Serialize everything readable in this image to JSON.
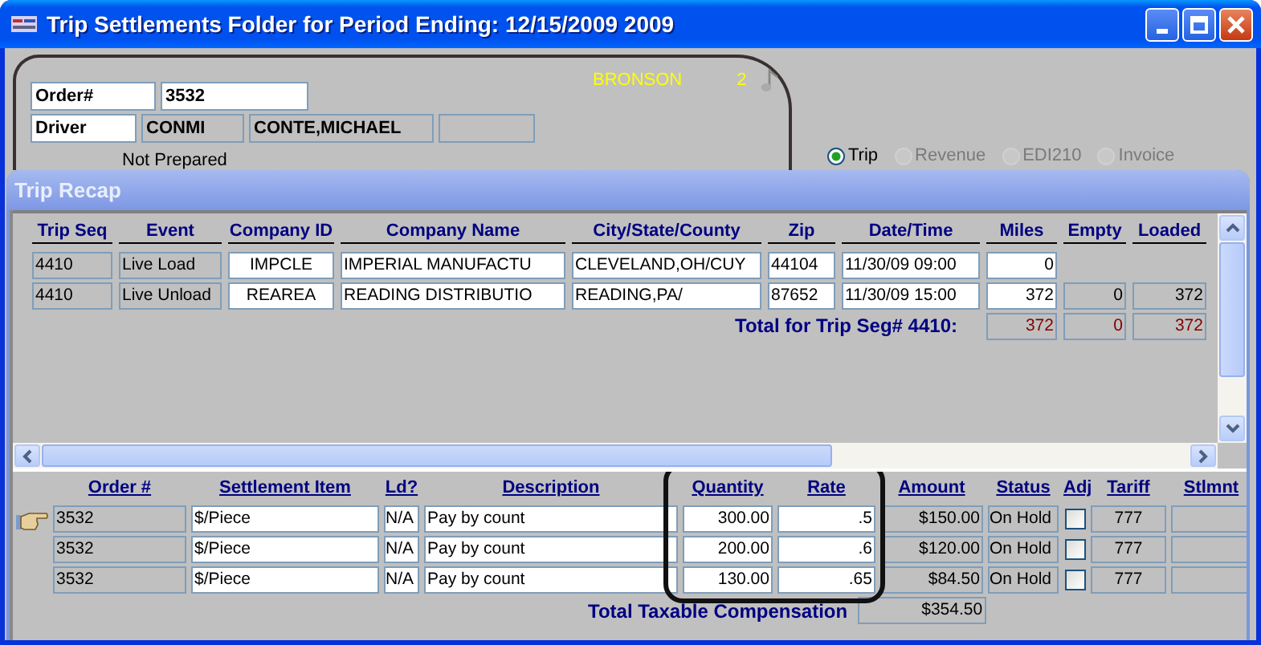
{
  "window": {
    "title": "Trip Settlements Folder for Period Ending: 12/15/2009 2009"
  },
  "header": {
    "order_label": "Order#",
    "order_value": "3532",
    "driver_label": "Driver",
    "driver_id": "CONMI",
    "driver_name": "CONTE,MICHAEL",
    "status": "Not Prepared",
    "terminal": "BRONSON",
    "count": "2"
  },
  "view_options": [
    {
      "label": "Trip",
      "selected": true,
      "disabled": false
    },
    {
      "label": "Revenue",
      "selected": false,
      "disabled": true
    },
    {
      "label": "EDI210",
      "selected": false,
      "disabled": true
    },
    {
      "label": "Invoice",
      "selected": false,
      "disabled": true
    }
  ],
  "trip_recap": {
    "title": "Trip Recap",
    "columns": [
      "Trip Seq",
      "Event",
      "Company ID",
      "Company Name",
      "City/State/County",
      "Zip",
      "Date/Time",
      "Miles",
      "Empty",
      "Loaded"
    ],
    "rows": [
      {
        "cells": [
          "4410",
          "Live Load",
          "IMPCLE",
          "IMPERIAL MANUFACTU",
          "CLEVELAND,OH/CUY",
          "44104",
          "11/30/09 09:00",
          "0"
        ]
      },
      {
        "cells": [
          "4410",
          "Live Unload",
          "REAREA",
          "READING DISTRIBUTIO",
          "READING,PA/",
          "87652",
          "11/30/09 15:00",
          "372",
          "0",
          "372"
        ]
      }
    ],
    "total": {
      "label": "Total for Trip Seg# 4410:",
      "miles": "372",
      "empty": "0",
      "loaded": "372"
    }
  },
  "settlements": {
    "columns": [
      "Order #",
      "Settlement Item",
      "Ld?",
      "Description",
      "Quantity",
      "Rate",
      "Amount",
      "Status",
      "Adj",
      "Tariff",
      "Stlmnt"
    ],
    "rows": [
      {
        "selected": true,
        "order": "3532",
        "item": "$/Piece",
        "ld": "N/A",
        "description": "Pay by count",
        "quantity": "300.00",
        "rate": ".5",
        "amount": "$150.00",
        "status": "On Hold",
        "adj": false,
        "tariff": "777"
      },
      {
        "selected": false,
        "order": "3532",
        "item": "$/Piece",
        "ld": "N/A",
        "description": "Pay by count",
        "quantity": "200.00",
        "rate": ".6",
        "amount": "$120.00",
        "status": "On Hold",
        "adj": false,
        "tariff": "777"
      },
      {
        "selected": false,
        "order": "3532",
        "item": "$/Piece",
        "ld": "N/A",
        "description": "Pay by count",
        "quantity": "130.00",
        "rate": ".65",
        "amount": "$84.50",
        "status": "On Hold",
        "adj": false,
        "tariff": "777"
      }
    ],
    "total": {
      "label": "Total Taxable Compensation",
      "amount": "$354.50"
    }
  }
}
